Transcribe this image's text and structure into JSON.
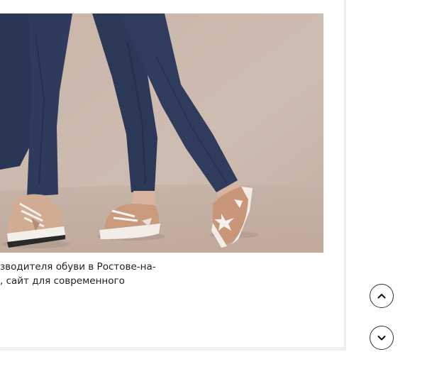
{
  "project": {
    "image_icon": "sneakers-photo",
    "description_lines": [
      "зводителя обуви в Ростове-на-",
      ", сайт для современного"
    ]
  },
  "navigation": {
    "up_icon": "chevron-up-icon",
    "down_icon": "chevron-down-icon"
  },
  "colors": {
    "background": "#ffffff",
    "photo_backdrop": "#c8b6aa",
    "jeans": "#2b3858",
    "sneakers": "#c99a7c",
    "text": "#222222",
    "button_border": "#333333"
  }
}
